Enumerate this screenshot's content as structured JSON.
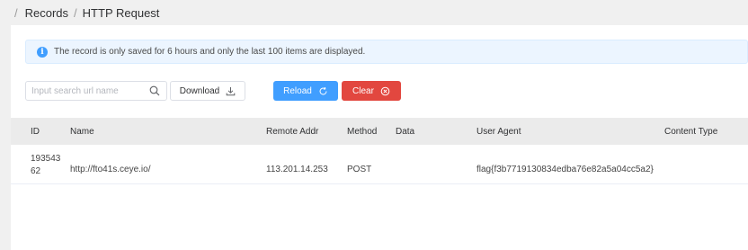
{
  "breadcrumb": {
    "separator": "/",
    "items": [
      "Records",
      "HTTP Request"
    ]
  },
  "alert": {
    "icon": "info-icon",
    "text": "The record is only saved for 6 hours and only the last 100 items are displayed."
  },
  "toolbar": {
    "search_placeholder": "Input search url name",
    "download_label": "Download",
    "reload_label": "Reload",
    "clear_label": "Clear"
  },
  "table": {
    "columns": [
      "ID",
      "Name",
      "Remote Addr",
      "Method",
      "Data",
      "User Agent",
      "Content Type"
    ],
    "rows": [
      {
        "id_line1": "193543",
        "id_line2": "62",
        "name": "http://fto41s.ceye.io/",
        "remote_addr": "113.201.14.253",
        "method": "POST",
        "data": "",
        "user_agent": "flag{f3b7719130834edba76e82a5a04cc5a2}",
        "content_type": ""
      }
    ]
  },
  "colors": {
    "primary": "#409eff",
    "danger": "#e2473f",
    "alert_bg": "#ecf5ff",
    "header_bg": "#ebebeb"
  }
}
